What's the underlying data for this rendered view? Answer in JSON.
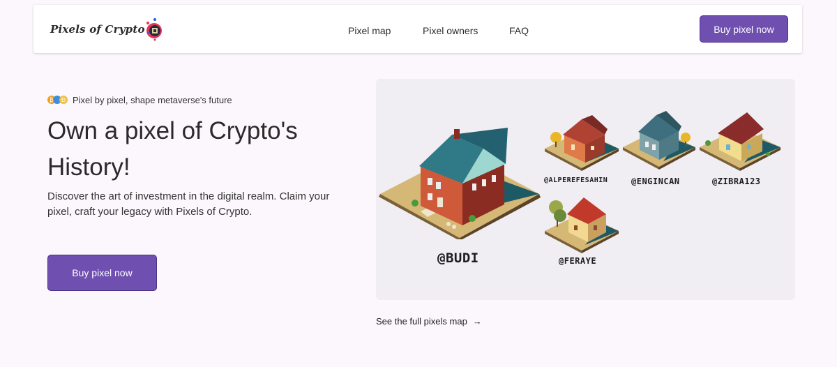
{
  "nav": {
    "logo_text": "Pixels of Crypto",
    "links": [
      "Pixel map",
      "Pixel owners",
      "FAQ"
    ],
    "cta": "Buy pixel now"
  },
  "hero": {
    "tagline": "Pixel by pixel, shape metaverse's future",
    "title": "Own a pixel of Crypto's History!",
    "description": "Discover the art of investment in the digital realm. Claim your pixel, craft your legacy with Pixels of Crypto.",
    "cta": "Buy pixel now"
  },
  "showcase": {
    "owners": [
      "@BUDI",
      "@ALPEREFESAHIN",
      "@ENGINCAN",
      "@ZIBRA123",
      "@FERAYE"
    ],
    "map_link": "See the full pixels map"
  },
  "colors": {
    "accent": "#6f4fb0",
    "page_bg": "#fcf7fc",
    "panel_bg": "#f0edf3"
  }
}
